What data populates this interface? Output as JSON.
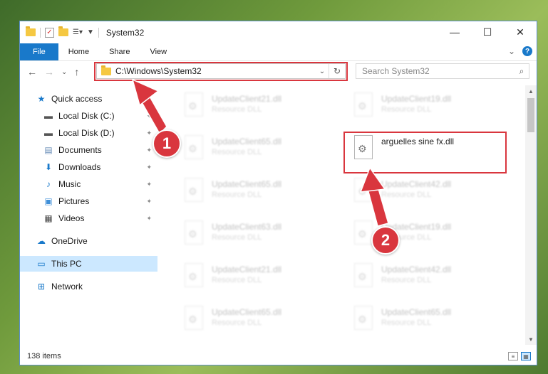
{
  "window": {
    "title": "System32",
    "controls": {
      "minimize": "—",
      "maximize": "☐",
      "close": "✕"
    }
  },
  "ribbon": {
    "tabs": [
      "File",
      "Home",
      "Share",
      "View"
    ],
    "expand_glyph": "⌄",
    "help_glyph": "?"
  },
  "nav": {
    "back": "←",
    "forward": "→",
    "recent": "⌄",
    "up": "↑",
    "address": "C:\\Windows\\System32",
    "address_chevron": "⌄",
    "refresh": "↻",
    "search_placeholder": "Search System32",
    "search_glyph": "⌕"
  },
  "sidebar": {
    "items": [
      {
        "label": "Quick access",
        "icon": "star-icon",
        "glyph": "★",
        "color": "#1979ca",
        "pinned": false
      },
      {
        "label": "Local Disk (C:)",
        "icon": "drive-icon",
        "glyph": "▬",
        "color": "#555555",
        "pinned": true
      },
      {
        "label": "Local Disk (D:)",
        "icon": "drive-icon",
        "glyph": "▬",
        "color": "#555555",
        "pinned": true
      },
      {
        "label": "Documents",
        "icon": "documents-icon",
        "glyph": "▤",
        "color": "#6b8fb8",
        "pinned": true
      },
      {
        "label": "Downloads",
        "icon": "download-icon",
        "glyph": "⬇",
        "color": "#1979ca",
        "pinned": true
      },
      {
        "label": "Music",
        "icon": "music-icon",
        "glyph": "♪",
        "color": "#1979ca",
        "pinned": true
      },
      {
        "label": "Pictures",
        "icon": "pictures-icon",
        "glyph": "▣",
        "color": "#3f8fd8",
        "pinned": true
      },
      {
        "label": "Videos",
        "icon": "videos-icon",
        "glyph": "▦",
        "color": "#444444",
        "pinned": true
      },
      {
        "label": "OneDrive",
        "icon": "cloud-icon",
        "glyph": "☁",
        "color": "#1979ca",
        "pinned": false
      },
      {
        "label": "This PC",
        "icon": "computer-icon",
        "glyph": "▭",
        "color": "#1979ca",
        "pinned": false,
        "selected": true
      },
      {
        "label": "Network",
        "icon": "network-icon",
        "glyph": "⊞",
        "color": "#1979ca",
        "pinned": false
      }
    ],
    "pin_glyph": "📌"
  },
  "files": {
    "left_column": [
      {
        "name": "UpdateClient21.dll",
        "type": "Resource DLL"
      },
      {
        "name": "UpdateClient65.dll",
        "type": "Resource DLL"
      },
      {
        "name": "UpdateClient65.dll",
        "type": "Resource DLL"
      },
      {
        "name": "UpdateClient63.dll",
        "type": "Resource DLL"
      },
      {
        "name": "UpdateClient21.dll",
        "type": "Resource DLL"
      },
      {
        "name": "UpdateClient65.dll",
        "type": "Resource DLL"
      }
    ],
    "right_column": [
      {
        "name": "UpdateClient19.dll",
        "type": "Resource DLL"
      },
      {
        "name": "arguelles sine fx.dll",
        "type": "",
        "highlighted": true
      },
      {
        "name": "UpdateClient42.dll",
        "type": "Resource DLL"
      },
      {
        "name": "UpdateClient19.dll",
        "type": "Resource DLL"
      },
      {
        "name": "UpdateClient42.dll",
        "type": "Resource DLL"
      },
      {
        "name": "UpdateClient65.dll",
        "type": "Resource DLL"
      }
    ]
  },
  "status": {
    "item_count": "138 items"
  },
  "annotations": {
    "badge_1": "1",
    "badge_2": "2",
    "color": "#d9363e"
  }
}
